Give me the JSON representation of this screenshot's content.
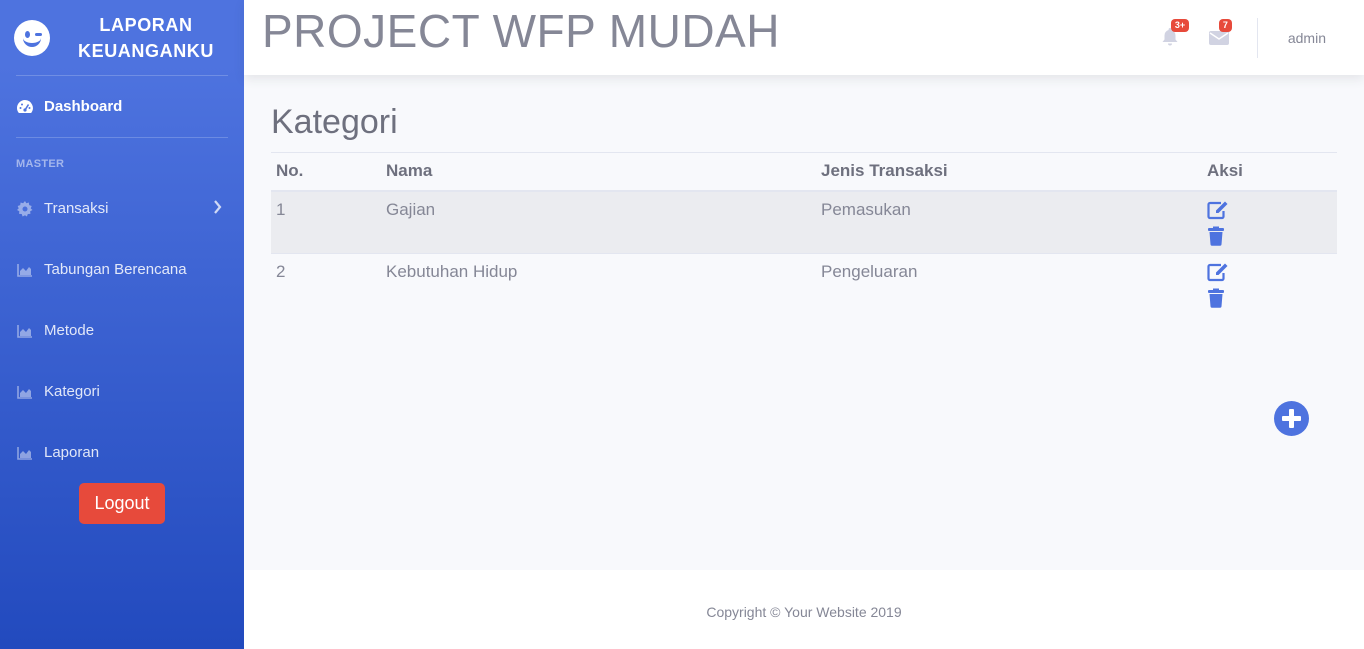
{
  "sidebar": {
    "brand": "LAPORAN KEUANGANKU",
    "dashboard": "Dashboard",
    "heading_master": "MASTER",
    "items": [
      {
        "label": "Transaksi",
        "icon": "gear-icon"
      },
      {
        "label": "Tabungan Berencana",
        "icon": "chart-area-icon"
      },
      {
        "label": "Metode",
        "icon": "chart-area-icon"
      },
      {
        "label": "Kategori",
        "icon": "chart-area-icon"
      },
      {
        "label": "Laporan",
        "icon": "chart-area-icon"
      }
    ],
    "logout": "Logout"
  },
  "topbar": {
    "title": "PROJECT WFP MUDAH",
    "alerts_badge": "3+",
    "messages_badge": "7",
    "user": "admin"
  },
  "main": {
    "page_title": "Kategori",
    "table": {
      "headers": [
        "No.",
        "Nama",
        "Jenis Transaksi",
        "Aksi"
      ],
      "rows": [
        {
          "no": "1",
          "nama": "Gajian",
          "jenis": "Pemasukan"
        },
        {
          "no": "2",
          "nama": "Kebutuhan Hidup",
          "jenis": "Pengeluaran"
        }
      ]
    }
  },
  "footer": {
    "copyright": "Copyright © Your Website 2019"
  },
  "colors": {
    "primary": "#4e73df",
    "primary_dark": "#224abe",
    "danger": "#e74a3b",
    "text_muted": "#858796"
  }
}
